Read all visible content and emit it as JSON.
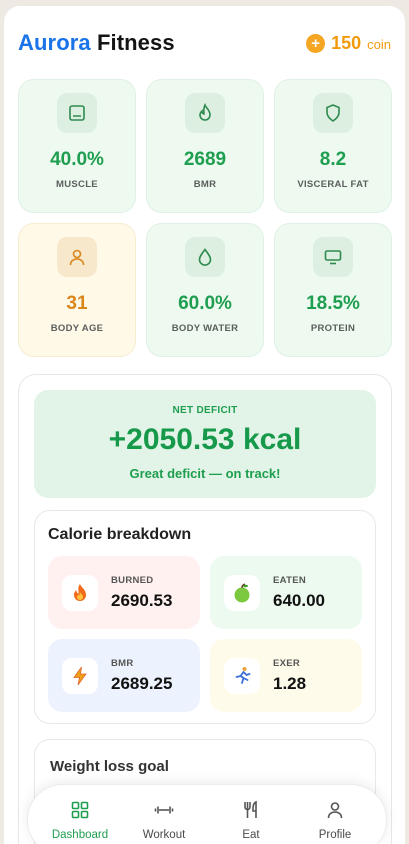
{
  "header": {
    "brand_part1": "Aurora",
    "brand_part2": "Fitness",
    "coin_icon": "+",
    "coin_value": "150",
    "coin_unit": "coin"
  },
  "metrics": [
    {
      "icon": "tablet-icon",
      "value": "40.0%",
      "label": "MUSCLE"
    },
    {
      "icon": "flame-icon",
      "value": "2689",
      "label": "BMR"
    },
    {
      "icon": "shield-icon",
      "value": "8.2",
      "label": "VISCERAL FAT"
    },
    {
      "icon": "person-icon",
      "value": "31",
      "label": "BODY AGE"
    },
    {
      "icon": "droplet-icon",
      "value": "60.0%",
      "label": "BODY WATER"
    },
    {
      "icon": "monitor-icon",
      "value": "18.5%",
      "label": "PROTEIN"
    }
  ],
  "deficit": {
    "label": "NET DEFICIT",
    "value": "+2050.53 kcal",
    "note": "Great deficit — on track!"
  },
  "breakdown": {
    "title": "Calorie breakdown",
    "items": [
      {
        "icon": "fire-icon",
        "label": "BURNED",
        "value": "2690.53"
      },
      {
        "icon": "apple-icon",
        "label": "EATEN",
        "value": "640.00"
      },
      {
        "icon": "lightning-icon",
        "label": "BMR",
        "value": "2689.25"
      },
      {
        "icon": "runner-icon",
        "label": "EXER",
        "value": "1.28"
      }
    ]
  },
  "goal": {
    "title": "Weight loss goal"
  },
  "nav": [
    {
      "icon": "dashboard-icon",
      "label": "Dashboard",
      "active": true
    },
    {
      "icon": "dumbbell-icon",
      "label": "Workout",
      "active": false
    },
    {
      "icon": "fork-knife-icon",
      "label": "Eat",
      "active": false
    },
    {
      "icon": "user-icon",
      "label": "Profile",
      "active": false
    }
  ],
  "colors": {
    "brand_blue": "#1a73e8",
    "accent_green": "#1e9e4f",
    "coin_orange": "#f29a0e",
    "warm_accent": "#d9861a"
  }
}
